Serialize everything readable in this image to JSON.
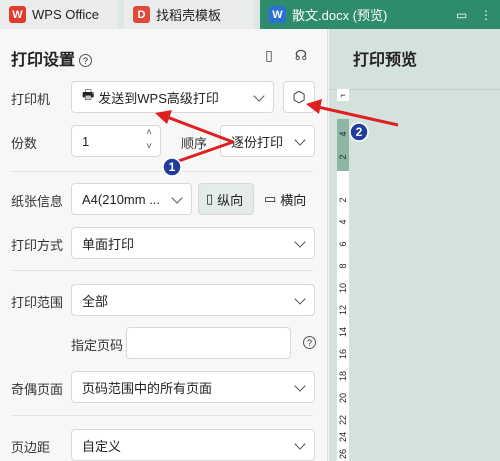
{
  "tabs": [
    {
      "label": "WPS Office",
      "icon": "wps-logo-icon"
    },
    {
      "label": "找稻壳模板",
      "icon": "docer-logo-icon"
    },
    {
      "label": "散文.docx (预览)",
      "icon": "word-doc-icon"
    }
  ],
  "panel": {
    "title": "打印设置",
    "printer": {
      "label": "打印机",
      "value": "发送到WPS高级打印"
    },
    "copies": {
      "label": "份数",
      "value": "1",
      "order_label": "顺序",
      "order_value": "逐份打印"
    },
    "paper": {
      "label": "纸张信息",
      "value": "A4(210mm ...",
      "portrait": "纵向",
      "landscape": "横向"
    },
    "print_mode": {
      "label": "打印方式",
      "value": "单面打印"
    },
    "print_range": {
      "label": "打印范围",
      "value": "全部",
      "page_label": "指定页码",
      "page_value": ""
    },
    "odd_even": {
      "label": "奇偶页面",
      "value": "页码范围中的所有页面"
    },
    "margin": {
      "label": "页边距",
      "value": "自定义"
    }
  },
  "preview": {
    "title": "打印预览",
    "ruler_numbers": [
      "4",
      "2",
      "2",
      "4",
      "6",
      "8",
      "10",
      "12",
      "14",
      "16",
      "18",
      "20",
      "22",
      "24",
      "26"
    ]
  },
  "annotations": [
    {
      "number": "1"
    },
    {
      "number": "2"
    }
  ],
  "colors": {
    "accent": "#2e8b6e",
    "arrow": "#e02020",
    "badge": "#1f3d99"
  }
}
